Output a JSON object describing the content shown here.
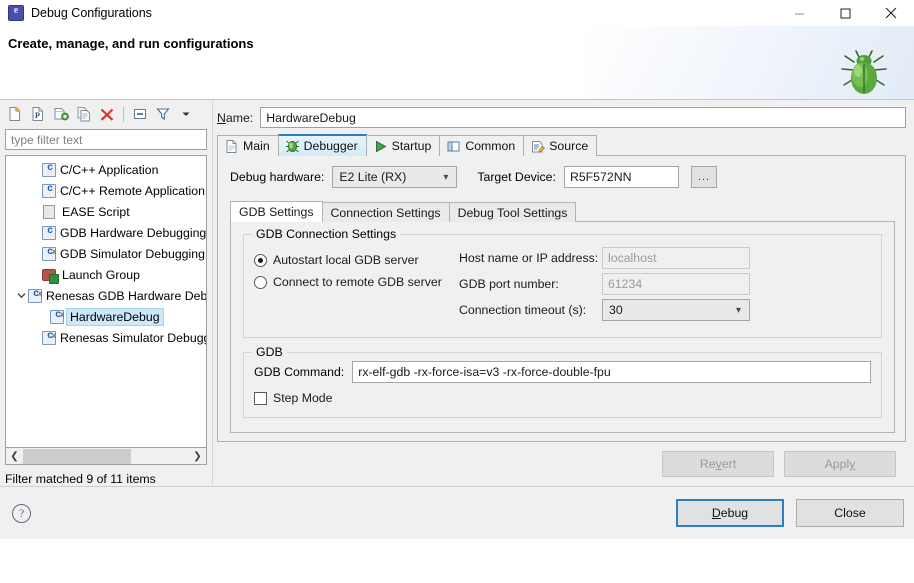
{
  "window": {
    "title": "Debug Configurations",
    "icon": "eclipse-icon",
    "minimize": "minimize-icon",
    "maximize": "maximize-icon",
    "close": "close-icon"
  },
  "banner": {
    "heading": "Create, manage, and run configurations",
    "graphic": "green-bug-icon"
  },
  "toolbar": {
    "items": [
      {
        "name": "new-configuration-icon",
        "tip": "New launch configuration"
      },
      {
        "name": "new-prototype-icon",
        "tip": "New prototype"
      },
      {
        "name": "export-configuration-icon",
        "tip": "Export"
      },
      {
        "name": "duplicate-configuration-icon",
        "tip": "Duplicate"
      },
      {
        "name": "delete-configuration-icon",
        "tip": "Delete"
      },
      {
        "name": "collapse-all-icon",
        "tip": "Collapse All"
      },
      {
        "name": "filter-icon",
        "tip": "Filter"
      },
      {
        "name": "view-menu-icon",
        "tip": "View Menu"
      }
    ]
  },
  "filter": {
    "placeholder": "type filter text",
    "value": ""
  },
  "tree": {
    "items": [
      {
        "label": "C/C++ Application",
        "icon": "c-app-icon",
        "indent": 1,
        "expander": "",
        "selected": false
      },
      {
        "label": "C/C++ Remote Application",
        "icon": "c-app-icon",
        "indent": 1,
        "expander": "",
        "selected": false
      },
      {
        "label": "EASE Script",
        "icon": "script-icon",
        "indent": 1,
        "expander": "",
        "selected": false
      },
      {
        "label": "GDB Hardware Debugging",
        "icon": "c-app-icon",
        "indent": 1,
        "expander": "",
        "selected": false
      },
      {
        "label": "GDB Simulator Debugging (RH…",
        "icon": "c-sim-icon",
        "indent": 1,
        "expander": "",
        "selected": false
      },
      {
        "label": "Launch Group",
        "icon": "launch-group-icon",
        "indent": 1,
        "expander": "",
        "selected": false
      },
      {
        "label": "Renesas GDB Hardware Debugg",
        "icon": "c-sim-icon",
        "indent": 0,
        "expander": "expanded",
        "selected": false
      },
      {
        "label": "HardwareDebug",
        "icon": "c-sim-icon",
        "indent": 2,
        "expander": "",
        "selected": true
      },
      {
        "label": "Renesas Simulator Debugging (",
        "icon": "c-sim-icon",
        "indent": 1,
        "expander": "",
        "selected": false
      }
    ],
    "scroll_left": "scroll-left-arrow",
    "scroll_right": "scroll-right-arrow"
  },
  "status": {
    "text": "Filter matched 9 of 11 items"
  },
  "name_field": {
    "label_pre": "N",
    "label_post": "ame:",
    "value": "HardwareDebug"
  },
  "tabs": [
    {
      "label": "Main",
      "icon": "main-tab-icon",
      "active": false
    },
    {
      "label": "Debugger",
      "icon": "debugger-tab-icon",
      "active": true
    },
    {
      "label": "Startup",
      "icon": "startup-tab-icon",
      "active": false
    },
    {
      "label": "Common",
      "icon": "common-tab-icon",
      "active": false
    },
    {
      "label": "Source",
      "icon": "source-tab-icon",
      "active": false
    }
  ],
  "debugger": {
    "hardware_label": "Debug hardware:",
    "hardware_value": "E2 Lite (RX)",
    "target_label": "Target Device:",
    "target_value": "R5F572NN",
    "browse_label": "...",
    "inner_tabs": [
      {
        "label": "GDB Settings",
        "active": true
      },
      {
        "label": "Connection Settings",
        "active": false
      },
      {
        "label": "Debug Tool Settings",
        "active": false
      }
    ],
    "connection_group": {
      "title": "GDB Connection Settings",
      "radios": [
        {
          "label": "Autostart local GDB server",
          "selected": true
        },
        {
          "label": "Connect to remote GDB server",
          "selected": false
        }
      ],
      "fields": [
        {
          "label": "Host name or IP address:",
          "value": "localhost",
          "type": "text",
          "disabled": true
        },
        {
          "label": "GDB port number:",
          "value": "61234",
          "type": "text",
          "disabled": true
        },
        {
          "label": "Connection timeout (s):",
          "value": "30",
          "type": "combo",
          "disabled": false
        }
      ]
    },
    "gdb_group": {
      "title": "GDB",
      "command_label": "GDB Command:",
      "command_value": "rx-elf-gdb -rx-force-isa=v3 -rx-force-double-fpu",
      "step_mode_label": "Step Mode",
      "step_mode_checked": false
    }
  },
  "buttons": {
    "revert_pre": "Re",
    "revert_mid": "v",
    "revert_post": "ert",
    "apply_pre": "Appl",
    "apply_mid": "y",
    "apply_post": "",
    "debug_pre": "",
    "debug_mid": "D",
    "debug_post": "ebug",
    "close": "Close",
    "help": "?"
  },
  "colors": {
    "accent": "#2b7ec1",
    "selection": "#cde8f6",
    "panel": "#f0f0f0",
    "disabled_text": "#9a9a9a"
  }
}
